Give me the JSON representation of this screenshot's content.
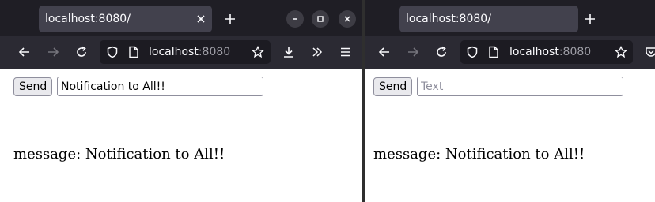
{
  "left_window": {
    "tab": {
      "title": "localhost:8080/"
    },
    "url": {
      "host": "localhost",
      "port": ":8080"
    },
    "form": {
      "send_label": "Send",
      "input_value": "Notification to All!!"
    },
    "message": "message: Notification to All!!"
  },
  "right_window": {
    "tab": {
      "title": "localhost:8080/"
    },
    "url": {
      "host": "localhost",
      "port": ":8080"
    },
    "form": {
      "send_label": "Send",
      "input_placeholder": "Text",
      "input_value": ""
    },
    "message": "message: Notification to All!!"
  }
}
